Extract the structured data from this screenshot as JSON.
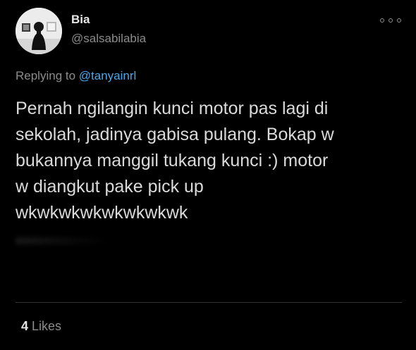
{
  "author": {
    "name": "Bia",
    "handle": "@salsabilabia"
  },
  "reply_context": {
    "prefix": "Replying to",
    "mention": "@tanyainrl"
  },
  "tweet_text": "Pernah ngilangin kunci motor pas lagi di\nsekolah, jadinya gabisa pulang. Bokap w\nbukannya manggil tukang kunci :) motor\nw diangkut pake pick up\nwkwkwkwkwkwkwkwk",
  "stats": {
    "likes_count": "4",
    "likes_label": "Likes"
  },
  "icons": {
    "more": "more-horizontal-icon"
  },
  "colors": {
    "background": "#000000",
    "mention": "#4ea6e8",
    "secondary_text": "#8b8b8b"
  }
}
